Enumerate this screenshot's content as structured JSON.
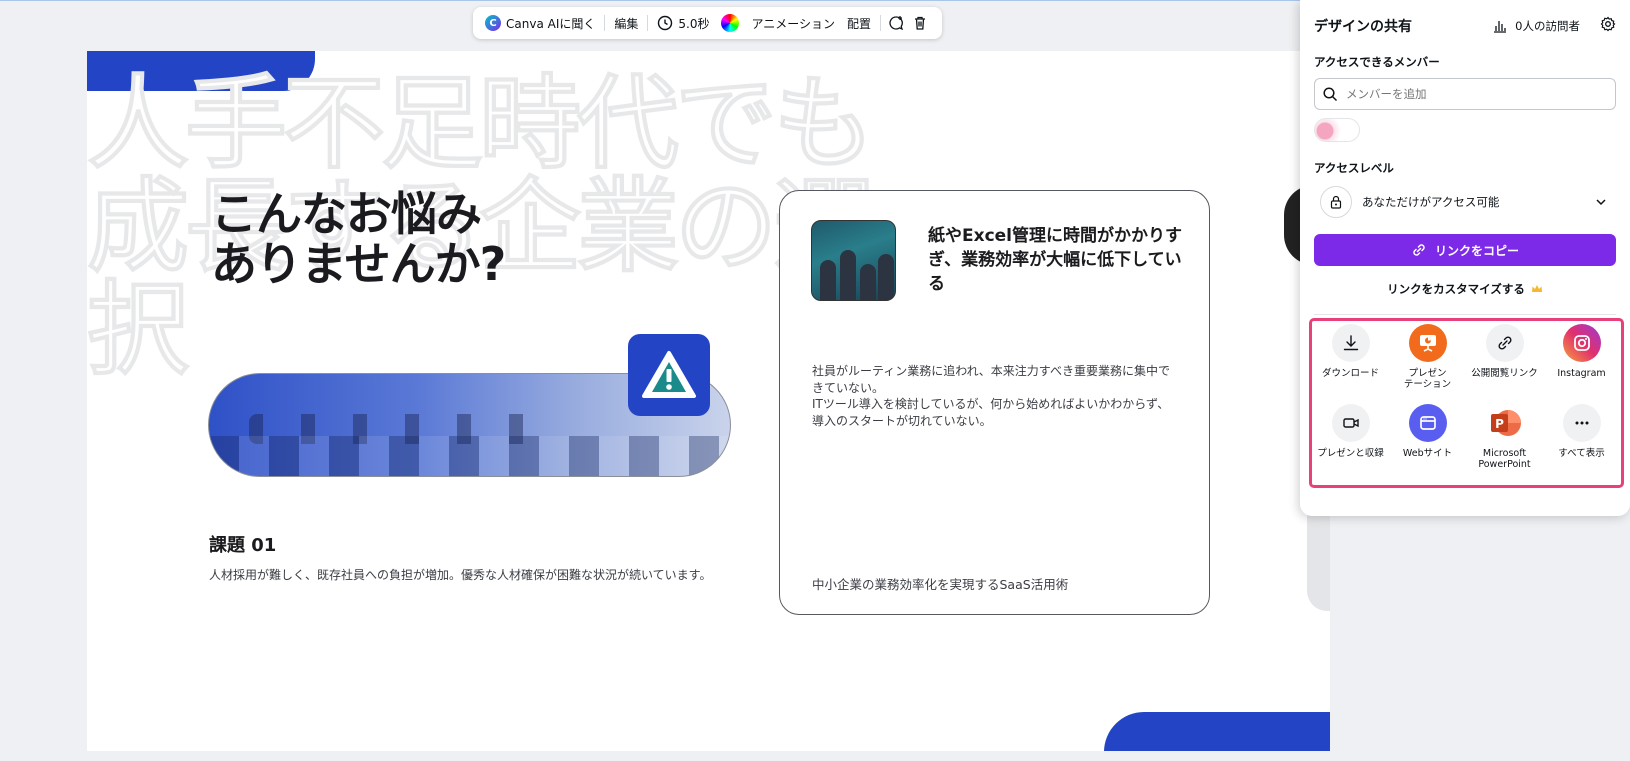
{
  "toolbar": {
    "ai_label": "Canva AIに聞く",
    "edit_label": "編集",
    "duration_label": "5.0秒",
    "animation_label": "アニメーション",
    "arrange_label": "配置"
  },
  "slide": {
    "ghost_text": "人手不足時代でも\n成長する企業の選\n択",
    "headline": "こんなお悩み\nありませんか?",
    "issue_title": "課題 01",
    "issue_desc": "人材採用が難しく、既存社員への負担が増加。優秀な人材確保が困難な状況が続いています。",
    "card_title": "紙やExcel管理に時間がかかりすぎ、業務効率が大幅に低下している",
    "card_body": "社員がルーティン業務に追われ、本来注力すべき重要業務に集中できていない。\nITツール導入を検討しているが、何から始めればよいかわからず、導入のスタートが切れていない。",
    "card_footer": "中小企業の業務効率化を実現するSaaS活用術"
  },
  "share_panel": {
    "title": "デザインの共有",
    "visitors": "0人の訪問者",
    "members_label": "アクセスできるメンバー",
    "search_placeholder": "メンバーを追加",
    "access_level_label": "アクセスレベル",
    "access_level_value": "あなただけがアクセス可能",
    "copy_link_button": "リンクをコピー",
    "customize_link": "リンクをカスタマイズする",
    "share_options": [
      {
        "label": "ダウンロード",
        "icon": "download-icon"
      },
      {
        "label": "プレゼン\nテーション",
        "icon": "present-icon"
      },
      {
        "label": "公開閲覧リンク",
        "icon": "link-icon"
      },
      {
        "label": "Instagram",
        "icon": "instagram-icon"
      },
      {
        "label": "プレゼンと収録",
        "icon": "record-icon"
      },
      {
        "label": "Webサイト",
        "icon": "website-icon"
      },
      {
        "label": "Microsoft\nPowerPoint",
        "icon": "powerpoint-icon"
      },
      {
        "label": "すべて表示",
        "icon": "more-icon"
      }
    ]
  },
  "colors": {
    "brand_blue": "#2344c4",
    "canva_purple": "#7d2ae8",
    "highlight_pink": "#e8407a"
  }
}
